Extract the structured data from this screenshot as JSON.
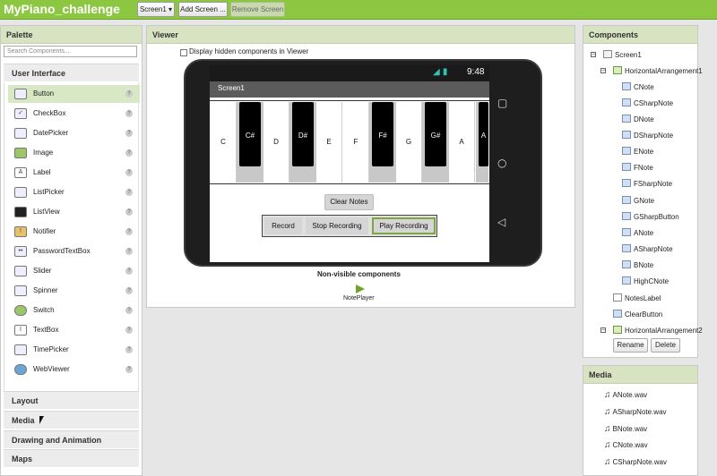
{
  "app": {
    "title": "MyPiano_challenge",
    "screen_select": "Screen1 ▾",
    "add_screen": "Add Screen ...",
    "remove_screen": "Remove Screen"
  },
  "palette": {
    "title": "Palette",
    "search_placeholder": "Search Components...",
    "open_category": "User Interface",
    "items": [
      {
        "label": "Button",
        "icon": "button-icon"
      },
      {
        "label": "CheckBox",
        "icon": "checkbox-icon"
      },
      {
        "label": "DatePicker",
        "icon": "datepicker-icon"
      },
      {
        "label": "Image",
        "icon": "image-icon"
      },
      {
        "label": "Label",
        "icon": "label-icon"
      },
      {
        "label": "ListPicker",
        "icon": "listpicker-icon"
      },
      {
        "label": "ListView",
        "icon": "listview-icon"
      },
      {
        "label": "Notifier",
        "icon": "notifier-icon"
      },
      {
        "label": "PasswordTextBox",
        "icon": "password-icon"
      },
      {
        "label": "Slider",
        "icon": "slider-icon"
      },
      {
        "label": "Spinner",
        "icon": "spinner-icon"
      },
      {
        "label": "Switch",
        "icon": "switch-icon"
      },
      {
        "label": "TextBox",
        "icon": "textbox-icon"
      },
      {
        "label": "TimePicker",
        "icon": "timepicker-icon"
      },
      {
        "label": "WebViewer",
        "icon": "webviewer-icon"
      }
    ],
    "help_glyph": "?",
    "categories": [
      "Layout",
      "Media",
      "Drawing and Animation",
      "Maps"
    ]
  },
  "viewer": {
    "title": "Viewer",
    "hidden_label": "Display hidden components in Viewer",
    "status_time": "9:48",
    "status_icons": "◢ ▮",
    "screen_title": "Screen1",
    "white_keys": [
      "C",
      "D",
      "E",
      "F",
      "G",
      "A"
    ],
    "black_keys": [
      "C#",
      "D#",
      "F#",
      "G#",
      "A"
    ],
    "clear_notes": "Clear Notes",
    "record": "Record",
    "stop_recording": "Stop Recording",
    "play_recording": "Play Recording",
    "nonvisible_title": "Non-visible components",
    "noteplayer": "NotePlayer"
  },
  "components": {
    "title": "Components",
    "tree": [
      {
        "label": "Screen1",
        "kind": "screen"
      },
      {
        "label": "HorizontalArrangement1",
        "kind": "arr"
      },
      {
        "label": "CNote",
        "kind": "btn"
      },
      {
        "label": "CSharpNote",
        "kind": "btn"
      },
      {
        "label": "DNote",
        "kind": "btn"
      },
      {
        "label": "DSharpNote",
        "kind": "btn"
      },
      {
        "label": "ENote",
        "kind": "btn"
      },
      {
        "label": "FNote",
        "kind": "btn"
      },
      {
        "label": "FSharpNote",
        "kind": "btn"
      },
      {
        "label": "GNote",
        "kind": "btn"
      },
      {
        "label": "GSharpButton",
        "kind": "btn"
      },
      {
        "label": "ANote",
        "kind": "btn"
      },
      {
        "label": "ASharpNote",
        "kind": "btn"
      },
      {
        "label": "BNote",
        "kind": "btn"
      },
      {
        "label": "HighCNote",
        "kind": "btn"
      },
      {
        "label": "NotesLabel",
        "kind": "label"
      },
      {
        "label": "ClearButton",
        "kind": "btn"
      },
      {
        "label": "HorizontalArrangement2",
        "kind": "arr"
      }
    ],
    "rename": "Rename",
    "delete": "Delete"
  },
  "media": {
    "title": "Media",
    "files": [
      "ANote.wav",
      "ASharpNote.wav",
      "BNote.wav",
      "CNote.wav",
      "CSharpNote.wav"
    ]
  }
}
